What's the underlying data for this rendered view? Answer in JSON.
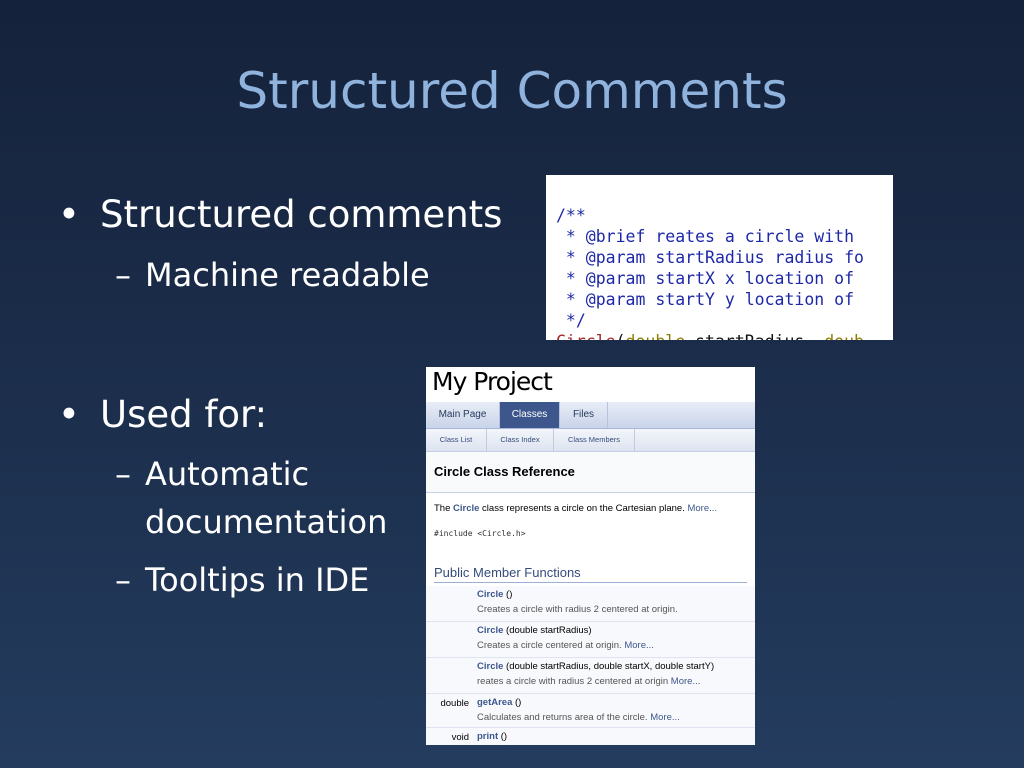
{
  "slide": {
    "title": "Structured Comments",
    "bullets": [
      {
        "text": "Structured comments",
        "subs": [
          "Machine readable"
        ]
      },
      {
        "text": "Used for:",
        "subs": [
          "Automatic",
          "documentation",
          "Tooltips in IDE"
        ]
      }
    ],
    "bullet_char": "•",
    "dash_char": "–"
  },
  "code": {
    "lines": [
      "/**",
      " * @brief reates a circle with",
      " * @param startRadius radius fo",
      " * @param startX x location of",
      " * @param startY y location of",
      " */"
    ],
    "last_fn": "Circle",
    "last_paren": "(",
    "last_kw1": "double",
    "last_mid": " startRadius, ",
    "last_kw2": "doub"
  },
  "doc": {
    "project": "My Project",
    "tabs": [
      "Main Page",
      "Classes",
      "Files"
    ],
    "active_tab": "Classes",
    "subtabs": [
      "Class List",
      "Class Index",
      "Class Members"
    ],
    "heading": "Circle Class Reference",
    "desc_pre": "The ",
    "desc_link": "Circle",
    "desc_post": " class represents a circle on the Cartesian plane. ",
    "desc_more": "More...",
    "include": "#include <Circle.h>",
    "section": "Public Member Functions",
    "members": [
      {
        "ret": "",
        "name": "Circle",
        "args": " ()",
        "brief": "Creates a circle with radius 2 centered at origin.",
        "more": ""
      },
      {
        "ret": "",
        "name": "Circle",
        "args": " (double startRadius)",
        "brief": "Creates a circle centered at origin. ",
        "more": "More..."
      },
      {
        "ret": "",
        "name": "Circle",
        "args": " (double startRadius, double startX, double startY)",
        "brief": "reates a circle with radius 2 centered at origin ",
        "more": "More..."
      },
      {
        "ret": "double",
        "name": "getArea",
        "args": " ()",
        "brief": "Calculates and returns area of the circle. ",
        "more": "More..."
      },
      {
        "ret": "void",
        "name": "print",
        "args": " ()",
        "brief": "",
        "more": ""
      }
    ]
  }
}
